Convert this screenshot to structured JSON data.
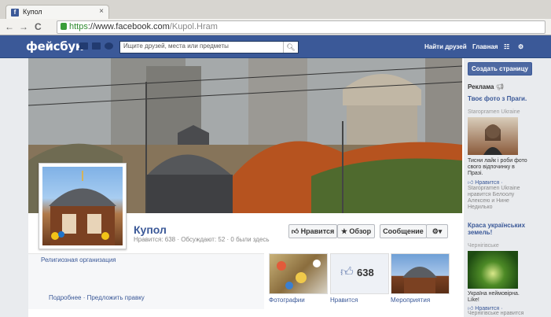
{
  "browser": {
    "tab_title": "Купол",
    "tab_close": "×",
    "url_scheme": "https",
    "url_sep": "://",
    "url_host": "www.facebook.com",
    "url_path": "/Kupol.Hram"
  },
  "fb": {
    "logo": "фейсбук",
    "search_placeholder": "Ищите друзей, места или предметы",
    "find_friends": "Найти друзей",
    "home": "Главная"
  },
  "page": {
    "name": "Купол",
    "stats": "Нравится: 638 · Обсуждают: 52 · 0 были здесь",
    "like_button": "Нравится",
    "review_button": "★ Обзор",
    "message_button": "Сообщение",
    "category": "Религиозная организация",
    "more_link": "Подробнее · Предложить правку",
    "likes_count": "638",
    "tiles": [
      "Фотографии",
      "Нравится",
      "Мероприятия"
    ]
  },
  "sidebar": {
    "create_page": "Создать страницу",
    "ads_header": "Реклама",
    "ad1": {
      "title": "Твоє фото з Праги.",
      "sponsor": "Staropramen Ukraine",
      "text": "Тисни лайк і роби фото свого відпочинку в Празі.",
      "like": "Нравится ·",
      "note": "Staropramen Ukraine нравится Белоолу Алексею и Нине Недилько"
    },
    "ad2": {
      "title": "Краса українських земель!",
      "sponsor": "Чернігівське",
      "text": "Україна неймовірна. Like!",
      "like": "Нравится ·",
      "note": "Чернігівське нравится"
    }
  }
}
